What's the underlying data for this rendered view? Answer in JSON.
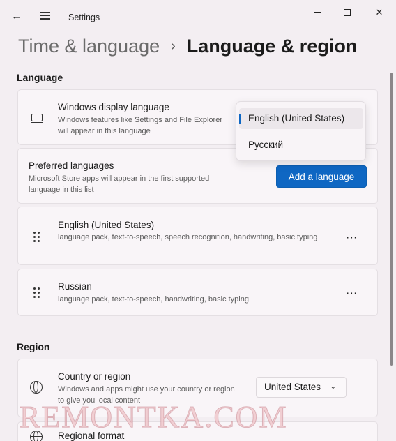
{
  "window": {
    "title": "Settings",
    "back_glyph": "←",
    "close_glyph": "✕"
  },
  "breadcrumb": {
    "parent": "Time & language",
    "separator": "›",
    "current": "Language & region"
  },
  "language_section": {
    "label": "Language",
    "display_language": {
      "title": "Windows display language",
      "description": "Windows features like Settings and File Explorer will appear in this language",
      "icon": "laptop-icon",
      "options": [
        {
          "label": "English (United States)",
          "selected": true
        },
        {
          "label": "Русский",
          "selected": false
        }
      ]
    },
    "preferred": {
      "title": "Preferred languages",
      "description": "Microsoft Store apps will appear in the first supported language in this list",
      "add_button": "Add a language"
    },
    "languages": [
      {
        "name": "English (United States)",
        "details": "language pack, text-to-speech, speech recognition, handwriting, basic typing",
        "more": "···"
      },
      {
        "name": "Russian",
        "details": "language pack, text-to-speech, handwriting, basic typing",
        "more": "···"
      }
    ]
  },
  "region_section": {
    "label": "Region",
    "country": {
      "title": "Country or region",
      "description": "Windows and apps might use your country or region to give you local content",
      "value": "United States",
      "chevron": "⌄",
      "icon": "globe-icon"
    },
    "regional_format": {
      "title": "Regional format"
    }
  },
  "watermark": "REMONTKA.COM",
  "colors": {
    "accent": "#0f67c3",
    "background": "#f3eef2",
    "card": "#f9f5f8"
  }
}
